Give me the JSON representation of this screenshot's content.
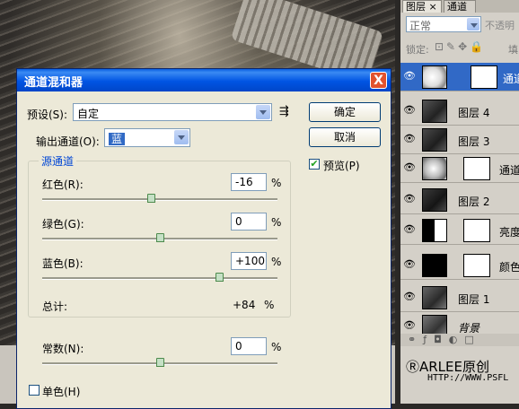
{
  "dialog": {
    "title": "通道混和器",
    "close": "X",
    "preset_label": "预设(S):",
    "preset_value": "自定",
    "output_label": "输出通道(O):",
    "output_value": "蓝",
    "ok": "确定",
    "cancel": "取消",
    "preview_label": "预览(P)",
    "preview_checked": true,
    "source_group": "源通道",
    "red_label": "红色(R):",
    "red_value": "-16",
    "red_level": -16,
    "green_label": "绿色(G):",
    "green_value": "0",
    "green_level": 0,
    "blue_label": "蓝色(B):",
    "blue_value": "+100",
    "blue_level": 100,
    "total_label": "总计:",
    "total_value": "+84",
    "percent": "%",
    "const_label": "常数(N):",
    "const_value": "0",
    "const_level": 0,
    "mono_label": "单色(H)",
    "mono_checked": false
  },
  "panel": {
    "tab_layers": "图层",
    "tab_channels": "通道",
    "blend_mode": "正常",
    "opacity_label": "不透明",
    "lock_label": "锁定:",
    "fill_label": "填",
    "layers": [
      {
        "name": "通道",
        "selected": true
      },
      {
        "name": "图层 4",
        "selected": false
      },
      {
        "name": "图层 3",
        "selected": false
      },
      {
        "name": "通道",
        "selected": false
      },
      {
        "name": "图层 2",
        "selected": false
      },
      {
        "name": "亮度",
        "selected": false
      },
      {
        "name": "颜色",
        "selected": false
      },
      {
        "name": "图层 1",
        "selected": false
      },
      {
        "name": "背景",
        "selected": false
      }
    ],
    "watermark": "ⓇARLEE原创",
    "watermark_url": "HTTP://WWW.PSFL"
  }
}
